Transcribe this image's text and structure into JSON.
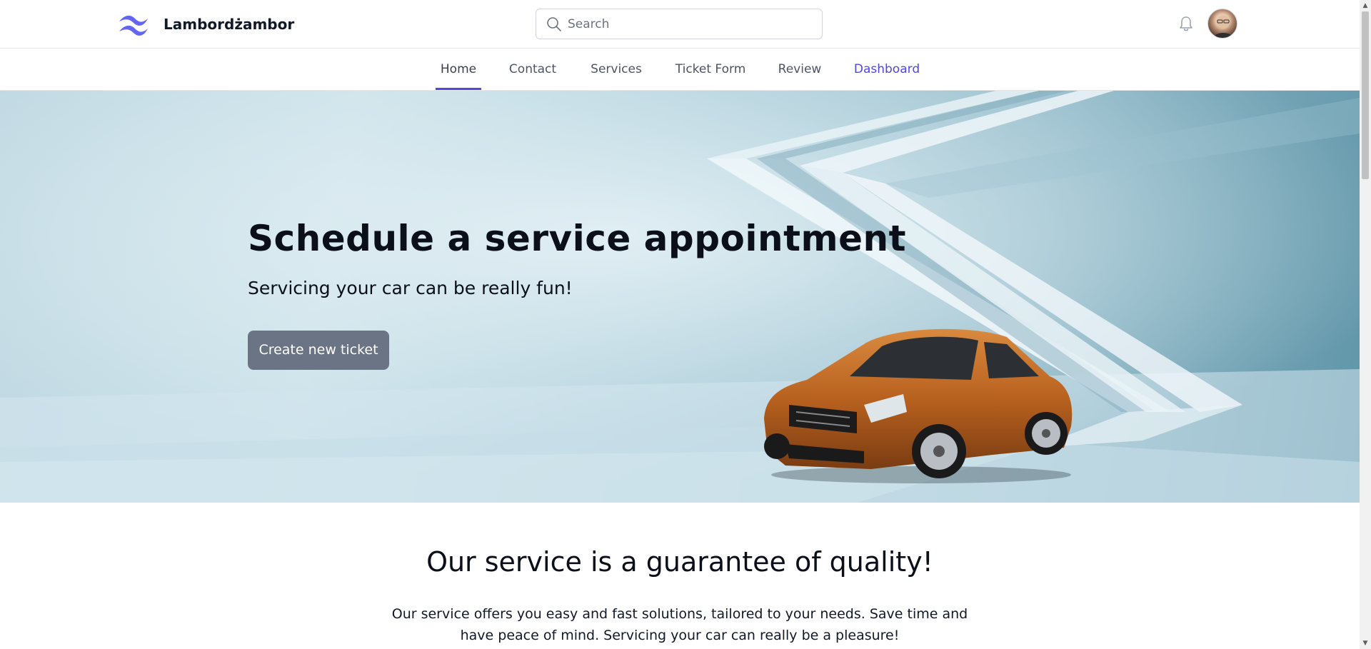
{
  "header": {
    "brand_name": "Lambordżambor",
    "logo_icon": "tailwind-wave-logo",
    "search_placeholder": "Search",
    "search_value": "",
    "notification_icon": "bell-icon",
    "avatar_icon": "user-avatar"
  },
  "nav": {
    "tabs": [
      {
        "label": "Home",
        "state": "active"
      },
      {
        "label": "Contact",
        "state": "normal"
      },
      {
        "label": "Services",
        "state": "normal"
      },
      {
        "label": "Ticket Form",
        "state": "normal"
      },
      {
        "label": "Review",
        "state": "normal"
      },
      {
        "label": "Dashboard",
        "state": "highlight"
      }
    ]
  },
  "hero": {
    "title": "Schedule a service appointment",
    "subtitle": "Servicing your car can be really fun!",
    "cta_label": "Create new ticket",
    "image": "orange-sedan-car"
  },
  "section": {
    "title": "Our service is a guarantee of quality!",
    "text": "Our service offers you easy and fast solutions, tailored to your needs. Save time and have peace of mind. Servicing your car can really be a pleasure!"
  },
  "colors": {
    "accent": "#4f46e5",
    "cta_bg": "#6b7485",
    "text": "#111827"
  }
}
